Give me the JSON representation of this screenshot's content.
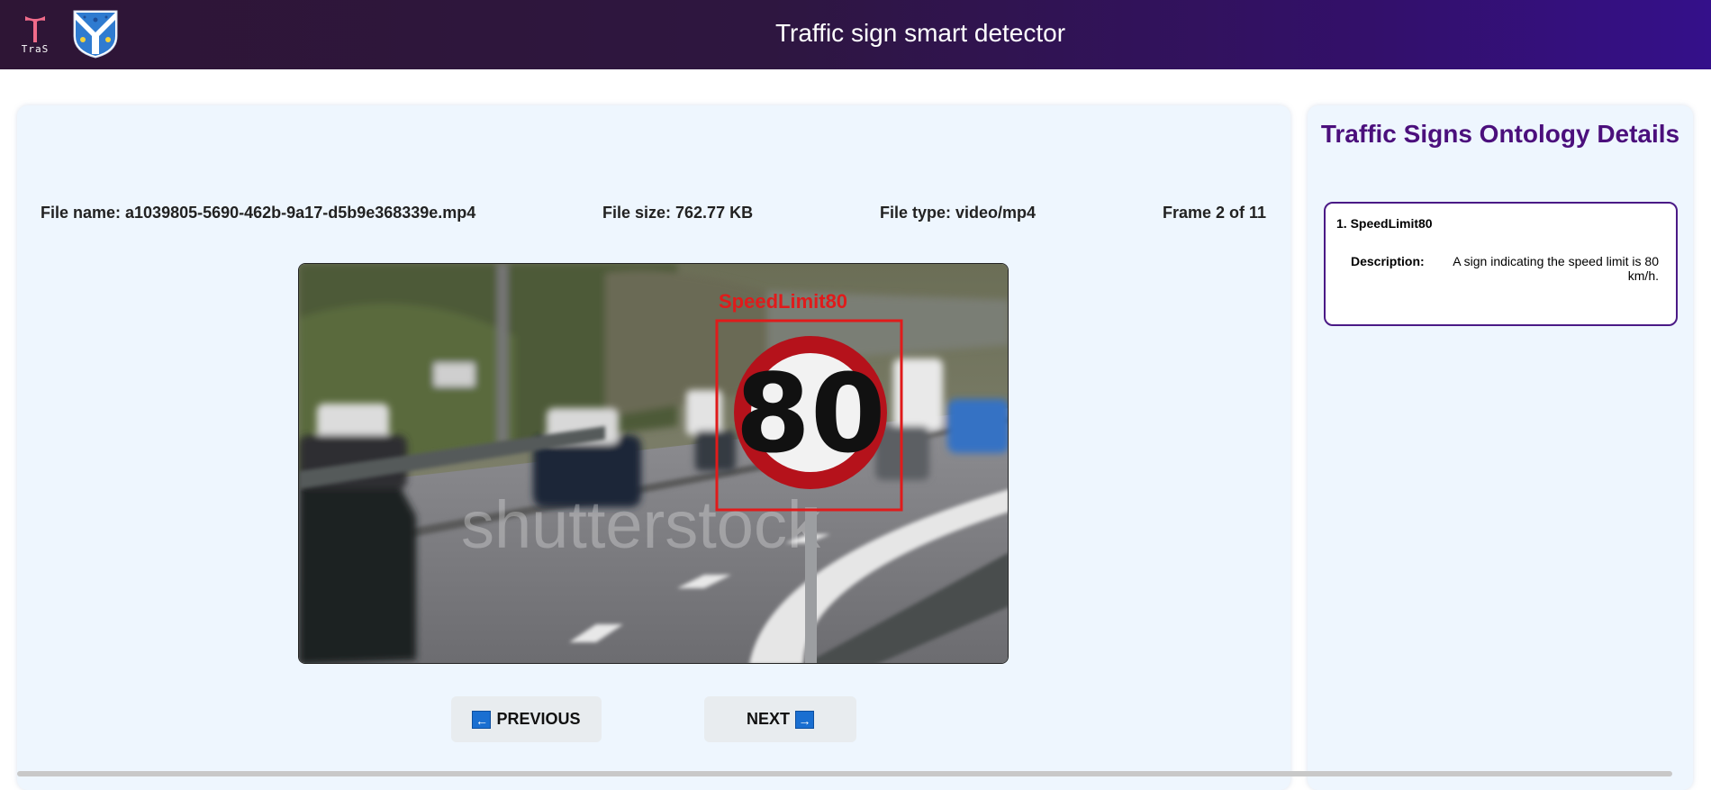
{
  "header": {
    "title": "Traffic sign smart detector",
    "logo_text": "TraS",
    "brand_color": "#2e1535",
    "accent_color": "#34108a"
  },
  "file_info": {
    "name": "File name: a1039805-5690-462b-9a17-d5b9e368339e.mp4",
    "size": "File size: 762.77 KB",
    "type": "File type: video/mp4",
    "frame": "Frame 2 of 11"
  },
  "frame": {
    "detection_label": "SpeedLimit80",
    "sign_number": "80",
    "watermark": "shutterstock",
    "box_color": "#e01b1b"
  },
  "navigation": {
    "prev_label": "PREVIOUS",
    "next_label": "NEXT",
    "prev_icon": "arrow-left-icon",
    "next_icon": "arrow-right-icon"
  },
  "ontology": {
    "title": "Traffic Signs Ontology Details",
    "items": [
      {
        "name": "1. SpeedLimit80",
        "description_label": "Description:",
        "description": "A sign indicating the speed limit is 80 km/h."
      }
    ]
  }
}
